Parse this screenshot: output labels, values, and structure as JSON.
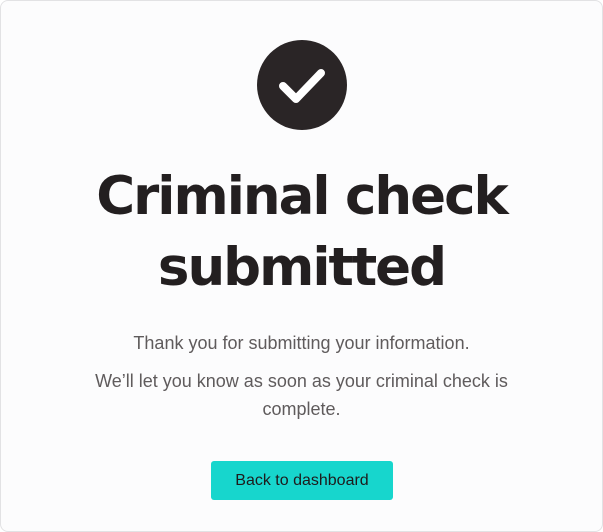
{
  "confirmation": {
    "icon": "checkmark-icon",
    "title": "Criminal check submitted",
    "message_line_1": "Thank you for submitting your information.",
    "message_line_2": "We’ll let you know as soon as your criminal check is complete.",
    "button_label": "Back to dashboard"
  },
  "colors": {
    "icon_background": "#2a2526",
    "title_text": "#231f20",
    "body_text": "#5f5b5c",
    "button_background": "#17d6cd",
    "card_border": "#e2e2e4"
  }
}
